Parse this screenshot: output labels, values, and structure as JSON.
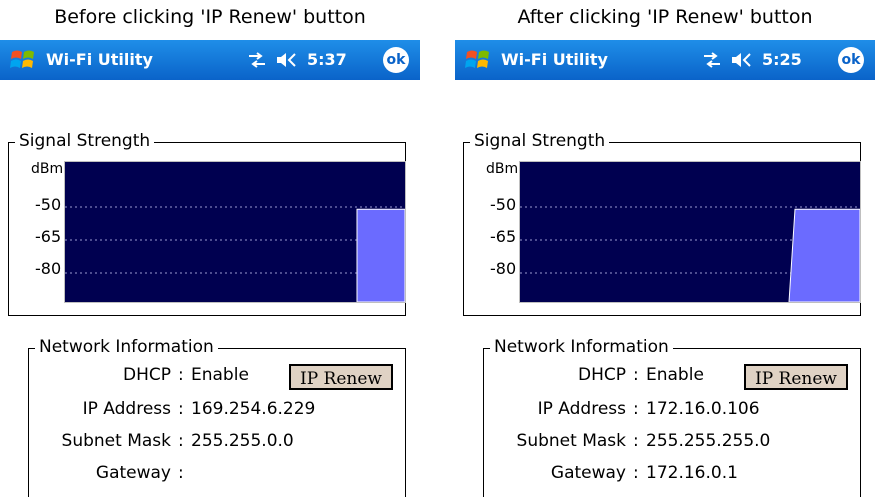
{
  "colors": {
    "titlebar": "#0a63c9",
    "plot_bg": "#000050",
    "signal_bar": "#6b6bff",
    "button_bg": "#dfd2c4"
  },
  "panels": [
    {
      "caption": "Before clicking 'IP Renew' button",
      "titlebar": {
        "app_title": "Wi-Fi Utility",
        "time": "5:37",
        "ok_label": "ok",
        "icons": [
          "windows-logo-icon",
          "connectivity-icon",
          "speaker-icon",
          "ok-icon"
        ]
      },
      "signal": {
        "legend": "Signal Strength",
        "unit": "dBm",
        "ticks": [
          "-50",
          "-65",
          "-80"
        ],
        "level_dbm": -51,
        "trace_start_fraction": 0.86,
        "trace_type": "step"
      },
      "network": {
        "legend": "Network Information",
        "dhcp_label": "DHCP",
        "dhcp_value": "Enable",
        "renew_label": "IP Renew",
        "ip_label": "IP Address",
        "ip_value": "169.254.6.229",
        "mask_label": "Subnet Mask",
        "mask_value": "255.255.0.0",
        "gateway_label": "Gateway",
        "gateway_value": ""
      }
    },
    {
      "caption": "After clicking 'IP Renew' button",
      "titlebar": {
        "app_title": "Wi-Fi Utility",
        "time": "5:25",
        "ok_label": "ok",
        "icons": [
          "windows-logo-icon",
          "connectivity-icon",
          "speaker-icon",
          "ok-icon"
        ]
      },
      "signal": {
        "legend": "Signal Strength",
        "unit": "dBm",
        "ticks": [
          "-50",
          "-65",
          "-80"
        ],
        "level_dbm": -51,
        "trace_start_fraction": 0.79,
        "trace_type": "ramp"
      },
      "network": {
        "legend": "Network Information",
        "dhcp_label": "DHCP",
        "dhcp_value": "Enable",
        "renew_label": "IP Renew",
        "ip_label": "IP Address",
        "ip_value": "172.16.0.106",
        "mask_label": "Subnet Mask",
        "mask_value": "255.255.255.0",
        "gateway_label": "Gateway",
        "gateway_value": "172.16.0.1"
      }
    }
  ]
}
